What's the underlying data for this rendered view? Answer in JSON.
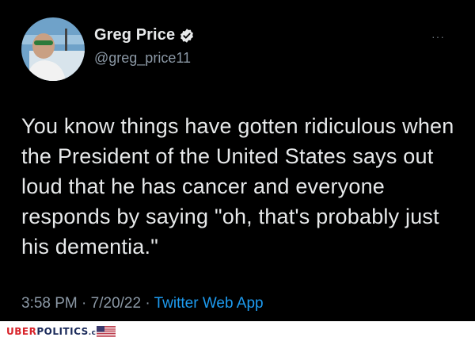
{
  "tweet": {
    "author_name": "Greg Price",
    "author_handle": "@greg_price11",
    "more_label": "···",
    "text": "You know things have gotten ridiculous when the President of the United States says out loud that he has cancer and everyone responds by saying \"oh, that's probably just his dementia.\"",
    "time": "3:58 PM",
    "separator": " · ",
    "date": "7/20/22",
    "source": "Twitter Web App"
  },
  "watermark": {
    "brand_red": "UBER",
    "brand_dark": "POLITICS",
    "brand_domain": ".com"
  },
  "colors": {
    "background": "#000000",
    "text": "#e7e9ea",
    "muted": "#8b98a5",
    "link": "#1d9bf0",
    "verified_badge": "#e7e9ea",
    "brand_red": "#d8232a"
  }
}
